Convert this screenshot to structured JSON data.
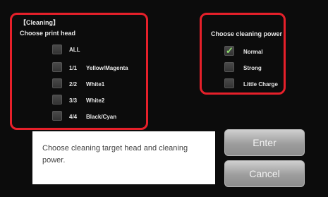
{
  "head_section": {
    "title": "【Cleaning】",
    "group_label": "Choose print head",
    "options": [
      {
        "number": "",
        "name": "ALL",
        "checked": false
      },
      {
        "number": "1/1",
        "name": "Yellow/Magenta",
        "checked": false
      },
      {
        "number": "2/2",
        "name": "White1",
        "checked": false
      },
      {
        "number": "3/3",
        "name": "White2",
        "checked": false
      },
      {
        "number": "4/4",
        "name": "Black/Cyan",
        "checked": false
      }
    ]
  },
  "power_section": {
    "group_label": "Choose cleaning power",
    "options": [
      {
        "name": "Normal",
        "checked": true
      },
      {
        "name": "Strong",
        "checked": false
      },
      {
        "name": "Little Charge",
        "checked": false
      }
    ]
  },
  "message": "Choose cleaning target head and cleaning power.",
  "buttons": {
    "enter": "Enter",
    "cancel": "Cancel"
  },
  "colors": {
    "highlight_border": "#e6202a",
    "checkmark": "#8fe06e",
    "background": "#0c0c0c"
  }
}
